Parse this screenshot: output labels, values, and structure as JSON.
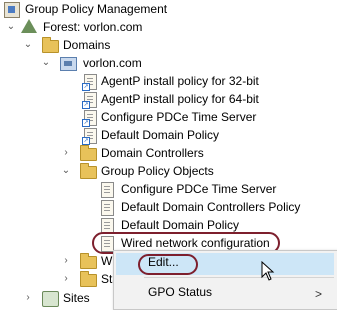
{
  "tree": {
    "root": "Group Policy Management",
    "forest": "Forest: vorlon.com",
    "domains": "Domains",
    "domain": "vorlon.com",
    "linked_gpos": [
      "AgentP install policy for 32-bit",
      "AgentP install policy for 64-bit",
      "Configure PDCe Time Server",
      "Default Domain Policy"
    ],
    "domain_controllers": "Domain Controllers",
    "gpo_container": "Group Policy Objects",
    "gpos": [
      "Configure PDCe Time Server",
      "Default Domain Controllers Policy",
      "Default Domain Policy",
      "Wired network configuration"
    ],
    "truncated_wmi": "WI",
    "truncated_starter": "Sta",
    "sites": "Sites"
  },
  "context_menu": {
    "items": [
      "Edit...",
      "GPO Status"
    ],
    "submenu_arrow": ">"
  },
  "colors": {
    "highlight_oval": "#7d1f2d",
    "menu_hover": "#cde6f7"
  }
}
